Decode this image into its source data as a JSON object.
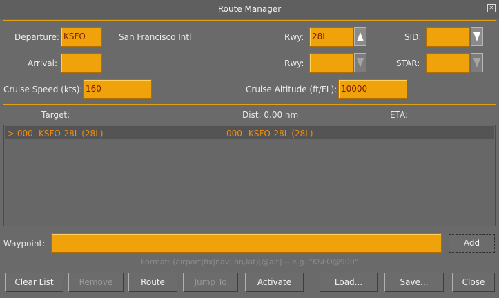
{
  "window": {
    "title": "Route Manager"
  },
  "departure": {
    "label": "Departure:",
    "value": "KSFO",
    "airport_name": "San Francisco Intl"
  },
  "arrival": {
    "label": "Arrival:",
    "value": ""
  },
  "dep_runway": {
    "label": "Rwy:",
    "value": "28L"
  },
  "arr_runway": {
    "label": "Rwy:",
    "value": ""
  },
  "sid": {
    "label": "SID:",
    "value": ""
  },
  "star": {
    "label": "STAR:",
    "value": ""
  },
  "cruise_speed": {
    "label": "Cruise Speed (kts):",
    "value": "160"
  },
  "cruise_altitude": {
    "label": "Cruise Altitude (ft/FL):",
    "value": "10000"
  },
  "list": {
    "header_target": "Target:",
    "header_dist": "Dist: 0.00 nm",
    "header_eta": "ETA:",
    "rows": [
      {
        "marker": "> 000",
        "name": "KSFO-28L (28L)",
        "index": "000",
        "name2": "KSFO-28L (28L)"
      }
    ]
  },
  "waypoint": {
    "label": "Waypoint:",
    "value": "",
    "add_label": "Add"
  },
  "hint": "Format: (airport|fix|nav|lon,lat)[@alt] -- e.g. \"KSFO@900\"",
  "buttons": {
    "clear_list": "Clear List",
    "remove": "Remove",
    "route": "Route",
    "jump_to": "Jump To",
    "activate": "Activate",
    "load": "Load...",
    "save": "Save...",
    "close": "Close"
  }
}
